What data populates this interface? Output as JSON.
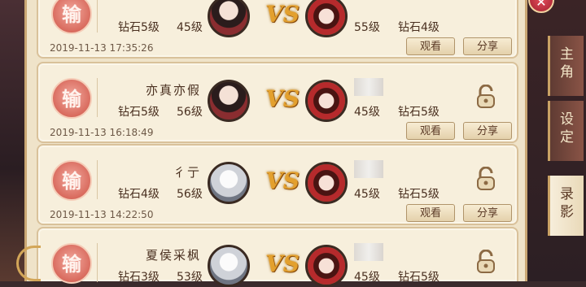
{
  "window": {
    "title": "设 定",
    "close_label": "✕"
  },
  "tabs": [
    {
      "label": "主\n角",
      "active": false
    },
    {
      "label": "设\n定",
      "active": false
    },
    {
      "label": "录\n影",
      "active": true
    }
  ],
  "records": [
    {
      "result": "输",
      "player1": {
        "name": "",
        "rank": "钻石5级",
        "level": "45级"
      },
      "player2": {
        "name": "",
        "level": "55级",
        "rank": "钻石4级"
      },
      "date": "2019-11-13 17:35:26",
      "watch_label": "观看",
      "share_label": "分享",
      "locked": false
    },
    {
      "result": "输",
      "player1": {
        "name": "亦真亦假",
        "rank": "钻石5级",
        "level": "56级"
      },
      "player2": {
        "name": "",
        "level": "45级",
        "rank": "钻石5级"
      },
      "date": "2019-11-13 16:18:49",
      "watch_label": "观看",
      "share_label": "分享",
      "locked": true
    },
    {
      "result": "输",
      "player1": {
        "name": "彳亍",
        "rank": "钻石4级",
        "level": "56级"
      },
      "player2": {
        "name": "",
        "level": "45级",
        "rank": "钻石5级"
      },
      "date": "2019-11-13 14:22:50",
      "watch_label": "观看",
      "share_label": "分享",
      "locked": true
    },
    {
      "result": "输",
      "player1": {
        "name": "夏侯采枫",
        "rank": "钻石3级",
        "level": "53级"
      },
      "player2": {
        "name": "",
        "level": "45级",
        "rank": "钻石5级"
      },
      "date": "",
      "watch_label": "",
      "share_label": "",
      "locked": true
    }
  ],
  "vs_label": "VS",
  "icons": {
    "lock": "unlock-icon",
    "close": "close-icon"
  },
  "colors": {
    "panel_bg": "#efe3c9",
    "loss_badge": "#d96b5e",
    "vs_gold": "#e3a02e"
  }
}
